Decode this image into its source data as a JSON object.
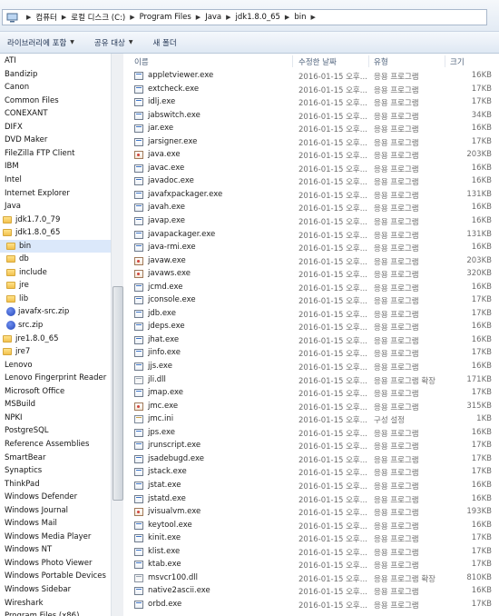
{
  "address": {
    "segments": [
      "컴퓨터",
      "로컬 디스크 (C:)",
      "Program Files",
      "Java",
      "jdk1.8.0_65",
      "bin"
    ]
  },
  "toolbar": {
    "library_label": "라이브러리에 포함",
    "share_label": "공유 대상",
    "new_folder_label": "새 폴더"
  },
  "nav": {
    "items": [
      {
        "label": "ATI",
        "level": 0,
        "kind": "text"
      },
      {
        "label": "Bandizip",
        "level": 0,
        "kind": "text"
      },
      {
        "label": "Canon",
        "level": 0,
        "kind": "text"
      },
      {
        "label": "Common Files",
        "level": 0,
        "kind": "text"
      },
      {
        "label": "CONEXANT",
        "level": 0,
        "kind": "text"
      },
      {
        "label": "DIFX",
        "level": 0,
        "kind": "text"
      },
      {
        "label": "DVD Maker",
        "level": 0,
        "kind": "text"
      },
      {
        "label": "FileZilla FTP Client",
        "level": 0,
        "kind": "text"
      },
      {
        "label": "IBM",
        "level": 0,
        "kind": "text"
      },
      {
        "label": "Intel",
        "level": 0,
        "kind": "text"
      },
      {
        "label": "Internet Explorer",
        "level": 0,
        "kind": "text"
      },
      {
        "label": "Java",
        "level": 0,
        "kind": "text"
      },
      {
        "label": "jdk1.7.0_79",
        "level": 1,
        "kind": "folder"
      },
      {
        "label": "jdk1.8.0_65",
        "level": 1,
        "kind": "folder"
      },
      {
        "label": "bin",
        "level": 2,
        "kind": "folder",
        "selected": true
      },
      {
        "label": "db",
        "level": 2,
        "kind": "folder"
      },
      {
        "label": "include",
        "level": 2,
        "kind": "folder"
      },
      {
        "label": "jre",
        "level": 2,
        "kind": "folder"
      },
      {
        "label": "lib",
        "level": 2,
        "kind": "folder"
      },
      {
        "label": "javafx-src.zip",
        "level": 2,
        "kind": "zip"
      },
      {
        "label": "src.zip",
        "level": 2,
        "kind": "zip"
      },
      {
        "label": "jre1.8.0_65",
        "level": 1,
        "kind": "folder"
      },
      {
        "label": "jre7",
        "level": 1,
        "kind": "folder"
      },
      {
        "label": "Lenovo",
        "level": 0,
        "kind": "text"
      },
      {
        "label": "Lenovo Fingerprint Reader",
        "level": 0,
        "kind": "text"
      },
      {
        "label": "Microsoft Office",
        "level": 0,
        "kind": "text"
      },
      {
        "label": "MSBuild",
        "level": 0,
        "kind": "text"
      },
      {
        "label": "NPKI",
        "level": 0,
        "kind": "text"
      },
      {
        "label": "PostgreSQL",
        "level": 0,
        "kind": "text"
      },
      {
        "label": "Reference Assemblies",
        "level": 0,
        "kind": "text"
      },
      {
        "label": "SmartBear",
        "level": 0,
        "kind": "text"
      },
      {
        "label": "Synaptics",
        "level": 0,
        "kind": "text"
      },
      {
        "label": "ThinkPad",
        "level": 0,
        "kind": "text"
      },
      {
        "label": "Windows Defender",
        "level": 0,
        "kind": "text"
      },
      {
        "label": "Windows Journal",
        "level": 0,
        "kind": "text"
      },
      {
        "label": "Windows Mail",
        "level": 0,
        "kind": "text"
      },
      {
        "label": "Windows Media Player",
        "level": 0,
        "kind": "text"
      },
      {
        "label": "Windows NT",
        "level": 0,
        "kind": "text"
      },
      {
        "label": "Windows Photo Viewer",
        "level": 0,
        "kind": "text"
      },
      {
        "label": "Windows Portable Devices",
        "level": 0,
        "kind": "text"
      },
      {
        "label": "Windows Sidebar",
        "level": 0,
        "kind": "text"
      },
      {
        "label": "Wireshark",
        "level": 0,
        "kind": "text"
      },
      {
        "label": "Program Files (x86)",
        "level": 0,
        "kind": "text"
      }
    ]
  },
  "columns": {
    "name": "이름",
    "date": "수정한 날짜",
    "type": "유형",
    "size": "크기"
  },
  "files": [
    {
      "name": "appletviewer.exe",
      "date": "2016-01-15 오후...",
      "type": "응용 프로그램",
      "size": "16KB",
      "icon": "exe"
    },
    {
      "name": "extcheck.exe",
      "date": "2016-01-15 오후...",
      "type": "응용 프로그램",
      "size": "17KB",
      "icon": "exe"
    },
    {
      "name": "idlj.exe",
      "date": "2016-01-15 오후...",
      "type": "응용 프로그램",
      "size": "17KB",
      "icon": "exe"
    },
    {
      "name": "jabswitch.exe",
      "date": "2016-01-15 오후...",
      "type": "응용 프로그램",
      "size": "34KB",
      "icon": "exe"
    },
    {
      "name": "jar.exe",
      "date": "2016-01-15 오후...",
      "type": "응용 프로그램",
      "size": "16KB",
      "icon": "exe"
    },
    {
      "name": "jarsigner.exe",
      "date": "2016-01-15 오후...",
      "type": "응용 프로그램",
      "size": "17KB",
      "icon": "exe"
    },
    {
      "name": "java.exe",
      "date": "2016-01-15 오후...",
      "type": "응용 프로그램",
      "size": "203KB",
      "icon": "java"
    },
    {
      "name": "javac.exe",
      "date": "2016-01-15 오후...",
      "type": "응용 프로그램",
      "size": "16KB",
      "icon": "exe"
    },
    {
      "name": "javadoc.exe",
      "date": "2016-01-15 오후...",
      "type": "응용 프로그램",
      "size": "16KB",
      "icon": "exe"
    },
    {
      "name": "javafxpackager.exe",
      "date": "2016-01-15 오후...",
      "type": "응용 프로그램",
      "size": "131KB",
      "icon": "exe"
    },
    {
      "name": "javah.exe",
      "date": "2016-01-15 오후...",
      "type": "응용 프로그램",
      "size": "16KB",
      "icon": "exe"
    },
    {
      "name": "javap.exe",
      "date": "2016-01-15 오후...",
      "type": "응용 프로그램",
      "size": "16KB",
      "icon": "exe"
    },
    {
      "name": "javapackager.exe",
      "date": "2016-01-15 오후...",
      "type": "응용 프로그램",
      "size": "131KB",
      "icon": "exe"
    },
    {
      "name": "java-rmi.exe",
      "date": "2016-01-15 오후...",
      "type": "응용 프로그램",
      "size": "16KB",
      "icon": "exe"
    },
    {
      "name": "javaw.exe",
      "date": "2016-01-15 오후...",
      "type": "응용 프로그램",
      "size": "203KB",
      "icon": "java"
    },
    {
      "name": "javaws.exe",
      "date": "2016-01-15 오후...",
      "type": "응용 프로그램",
      "size": "320KB",
      "icon": "java"
    },
    {
      "name": "jcmd.exe",
      "date": "2016-01-15 오후...",
      "type": "응용 프로그램",
      "size": "16KB",
      "icon": "exe"
    },
    {
      "name": "jconsole.exe",
      "date": "2016-01-15 오후...",
      "type": "응용 프로그램",
      "size": "17KB",
      "icon": "exe"
    },
    {
      "name": "jdb.exe",
      "date": "2016-01-15 오후...",
      "type": "응용 프로그램",
      "size": "17KB",
      "icon": "exe"
    },
    {
      "name": "jdeps.exe",
      "date": "2016-01-15 오후...",
      "type": "응용 프로그램",
      "size": "16KB",
      "icon": "exe"
    },
    {
      "name": "jhat.exe",
      "date": "2016-01-15 오후...",
      "type": "응용 프로그램",
      "size": "16KB",
      "icon": "exe"
    },
    {
      "name": "jinfo.exe",
      "date": "2016-01-15 오후...",
      "type": "응용 프로그램",
      "size": "17KB",
      "icon": "exe"
    },
    {
      "name": "jjs.exe",
      "date": "2016-01-15 오후...",
      "type": "응용 프로그램",
      "size": "16KB",
      "icon": "exe"
    },
    {
      "name": "jli.dll",
      "date": "2016-01-15 오후...",
      "type": "응용 프로그램 확장",
      "size": "171KB",
      "icon": "dll"
    },
    {
      "name": "jmap.exe",
      "date": "2016-01-15 오후...",
      "type": "응용 프로그램",
      "size": "17KB",
      "icon": "exe"
    },
    {
      "name": "jmc.exe",
      "date": "2016-01-15 오후...",
      "type": "응용 프로그램",
      "size": "315KB",
      "icon": "java"
    },
    {
      "name": "jmc.ini",
      "date": "2016-01-15 오후...",
      "type": "구성 설정",
      "size": "1KB",
      "icon": "ini"
    },
    {
      "name": "jps.exe",
      "date": "2016-01-15 오후...",
      "type": "응용 프로그램",
      "size": "16KB",
      "icon": "exe"
    },
    {
      "name": "jrunscript.exe",
      "date": "2016-01-15 오후...",
      "type": "응용 프로그램",
      "size": "17KB",
      "icon": "exe"
    },
    {
      "name": "jsadebugd.exe",
      "date": "2016-01-15 오후...",
      "type": "응용 프로그램",
      "size": "17KB",
      "icon": "exe"
    },
    {
      "name": "jstack.exe",
      "date": "2016-01-15 오후...",
      "type": "응용 프로그램",
      "size": "17KB",
      "icon": "exe"
    },
    {
      "name": "jstat.exe",
      "date": "2016-01-15 오후...",
      "type": "응용 프로그램",
      "size": "16KB",
      "icon": "exe"
    },
    {
      "name": "jstatd.exe",
      "date": "2016-01-15 오후...",
      "type": "응용 프로그램",
      "size": "16KB",
      "icon": "exe"
    },
    {
      "name": "jvisualvm.exe",
      "date": "2016-01-15 오후...",
      "type": "응용 프로그램",
      "size": "193KB",
      "icon": "java"
    },
    {
      "name": "keytool.exe",
      "date": "2016-01-15 오후...",
      "type": "응용 프로그램",
      "size": "16KB",
      "icon": "exe"
    },
    {
      "name": "kinit.exe",
      "date": "2016-01-15 오후...",
      "type": "응용 프로그램",
      "size": "17KB",
      "icon": "exe"
    },
    {
      "name": "klist.exe",
      "date": "2016-01-15 오후...",
      "type": "응용 프로그램",
      "size": "17KB",
      "icon": "exe"
    },
    {
      "name": "ktab.exe",
      "date": "2016-01-15 오후...",
      "type": "응용 프로그램",
      "size": "17KB",
      "icon": "exe"
    },
    {
      "name": "msvcr100.dll",
      "date": "2016-01-15 오후...",
      "type": "응용 프로그램 확장",
      "size": "810KB",
      "icon": "dll"
    },
    {
      "name": "native2ascii.exe",
      "date": "2016-01-15 오후...",
      "type": "응용 프로그램",
      "size": "16KB",
      "icon": "exe"
    },
    {
      "name": "orbd.exe",
      "date": "2016-01-15 오후...",
      "type": "응용 프로그램",
      "size": "17KB",
      "icon": "exe"
    }
  ]
}
